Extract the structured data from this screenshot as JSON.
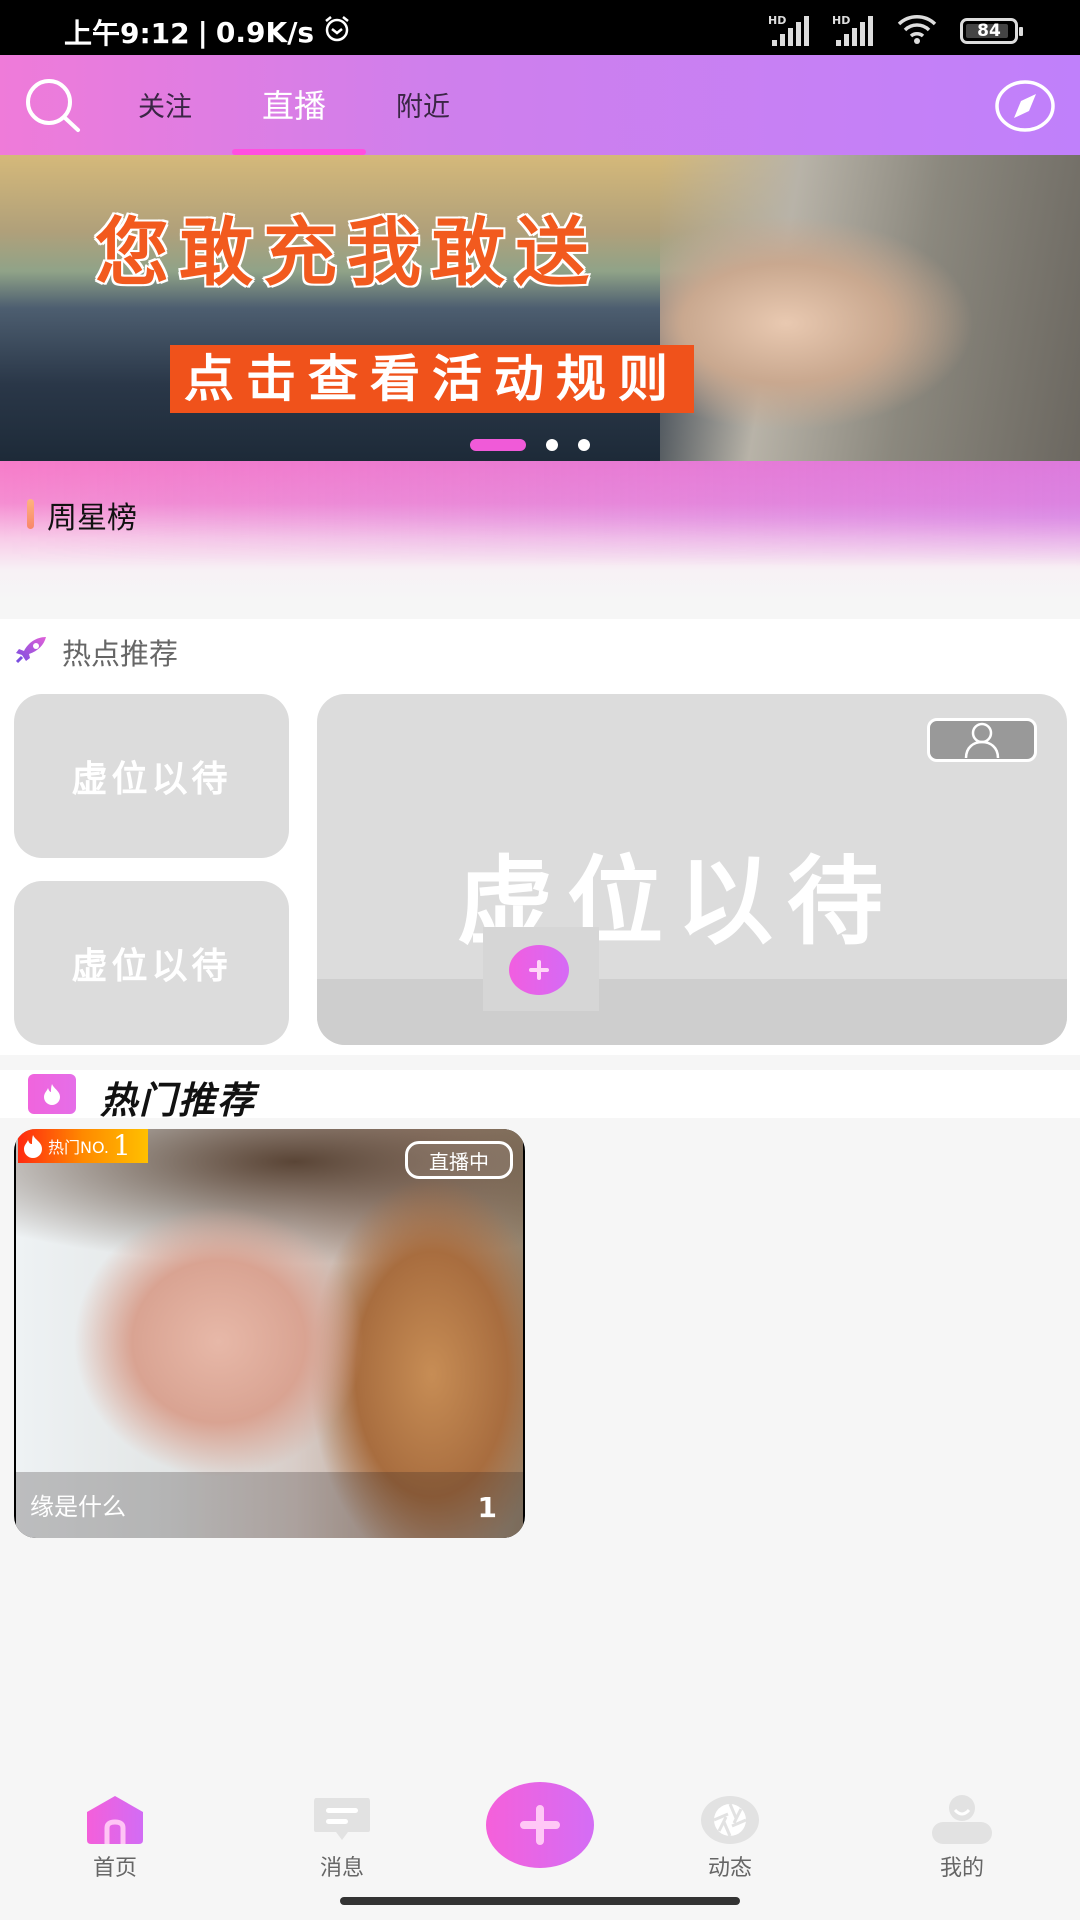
{
  "status_bar": {
    "time": "上午9:12",
    "separator": "|",
    "net_speed": "0.9K/s",
    "alarm_icon": "alarm-clock-icon",
    "sim1_label": "HD",
    "sim2_label": "HD",
    "wifi_icon": "wifi-icon",
    "battery": "84"
  },
  "top_nav": {
    "search_icon": "search-icon",
    "tabs": [
      {
        "label": "关注",
        "active": false
      },
      {
        "label": "直播",
        "active": true
      },
      {
        "label": "附近",
        "active": false
      }
    ],
    "compass_icon": "compass-icon",
    "accent_color": "#ff4fe0"
  },
  "banner": {
    "headline": "您敢充我敢送",
    "subline": "点击查看活动规则",
    "slide_count": 3,
    "active_slide": 1
  },
  "weekly_star": {
    "title": "周星榜"
  },
  "hot_spot": {
    "title": "热点推荐",
    "icon": "rocket-icon",
    "placeholders": [
      {
        "text": "虚位以待"
      },
      {
        "text": "虚位以待"
      },
      {
        "text": "虚位以待"
      }
    ]
  },
  "hot_recommend": {
    "title": "热门推荐",
    "icon": "fire-icon",
    "items": [
      {
        "rank_label": "热门NO.",
        "rank_number": "1",
        "live_badge": "直播中",
        "name": "缘是什么",
        "viewers": "1"
      }
    ]
  },
  "bottom_nav": {
    "items": [
      {
        "label": "首页",
        "icon": "home-icon",
        "active": true
      },
      {
        "label": "消息",
        "icon": "message-icon",
        "active": false
      },
      {
        "label": "",
        "icon": "plus-icon",
        "active": false
      },
      {
        "label": "动态",
        "icon": "aperture-icon",
        "active": false
      },
      {
        "label": "我的",
        "icon": "user-icon",
        "active": false
      }
    ]
  }
}
